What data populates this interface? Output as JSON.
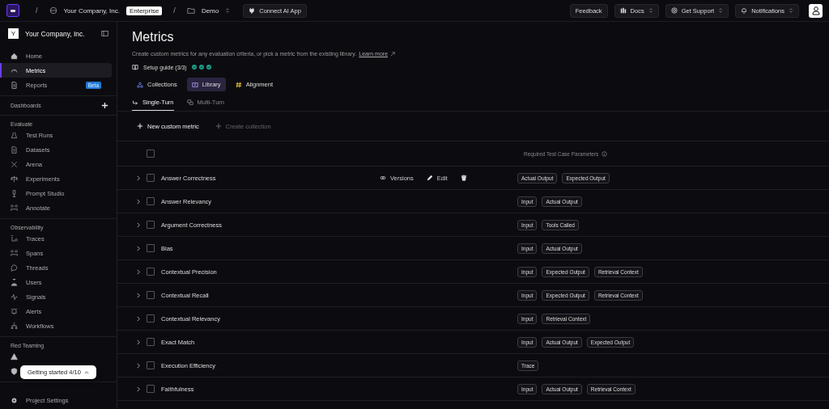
{
  "topbar": {
    "separators": [
      "/",
      "/"
    ],
    "org": "Your Company, Inc.",
    "plan": "Enterprise",
    "project": "Demo",
    "connect": "Connect AI App",
    "buttons": [
      {
        "label": "Feedback",
        "kind": "plain"
      },
      {
        "label": "Docs",
        "kind": "docs"
      },
      {
        "label": "Get Support",
        "kind": "support"
      },
      {
        "label": "Notifications",
        "kind": "bell"
      }
    ]
  },
  "sidebar": {
    "company": "Your Company, Inc.",
    "logo_letter": "Y",
    "top_items": [
      {
        "label": "Home",
        "selected": false
      },
      {
        "label": "Metrics",
        "selected": true
      },
      {
        "label": "Reports",
        "selected": false,
        "badge": "Beta"
      }
    ],
    "dashboards": "Dashboards",
    "sections": [
      {
        "title": "Evaluate",
        "items": [
          {
            "label": "Test Runs"
          },
          {
            "label": "Datasets"
          },
          {
            "label": "Arena"
          },
          {
            "label": "Experiments"
          },
          {
            "label": "Prompt Studio"
          },
          {
            "label": "Annotate"
          }
        ]
      },
      {
        "title": "Observability",
        "items": [
          {
            "label": "Traces"
          },
          {
            "label": "Spans"
          },
          {
            "label": "Threads"
          },
          {
            "label": "Users"
          },
          {
            "label": "Signals"
          },
          {
            "label": "Alerts"
          },
          {
            "label": "Workflows"
          }
        ]
      },
      {
        "title": "Red Teaming"
      }
    ],
    "settings": "Project Settings",
    "popup": "Getting started 4/10"
  },
  "page": {
    "title": "Metrics",
    "description": "Create custom metrics for any evaluation criteria, or pick a metric from the existing library.",
    "learn_more": "Learn more",
    "setup_guide": "Setup guide (3/3)",
    "setup_steps": [
      {
        "done": true
      },
      {
        "done": true
      },
      {
        "done": true
      }
    ],
    "tabs": [
      {
        "label": "Collections",
        "selected": false
      },
      {
        "label": "Library",
        "selected": true
      },
      {
        "label": "Alignment",
        "selected": false
      }
    ],
    "subtabs": [
      {
        "label": "Single-Turn",
        "selected": true
      },
      {
        "label": "Multi-Turn",
        "selected": false
      }
    ],
    "actions": [
      {
        "label": "New custom metric",
        "disabled": false
      },
      {
        "label": "Create collection",
        "disabled": true
      }
    ]
  },
  "table": {
    "header_checked": false,
    "params_header": "Required Test Case Parameters",
    "rows": [
      {
        "name": "Answer Correctness",
        "checked": false,
        "actions": [
          "Versions",
          "Edit"
        ],
        "params": [
          "Actual Output",
          "Expected Output"
        ]
      },
      {
        "name": "Answer Relevancy",
        "checked": false,
        "params": [
          "Input",
          "Actual Output"
        ]
      },
      {
        "name": "Argument Correctness",
        "checked": false,
        "params": [
          "Input",
          "Tools Called"
        ]
      },
      {
        "name": "Bias",
        "checked": false,
        "params": [
          "Input",
          "Actual Output"
        ]
      },
      {
        "name": "Contextual Precision",
        "checked": false,
        "params": [
          "Input",
          "Expected Output",
          "Retrieval Context"
        ]
      },
      {
        "name": "Contextual Recall",
        "checked": false,
        "params": [
          "Input",
          "Expected Output",
          "Retrieval Context"
        ]
      },
      {
        "name": "Contextual Relevancy",
        "checked": false,
        "params": [
          "Input",
          "Retrieval Context"
        ]
      },
      {
        "name": "Exact Match",
        "checked": false,
        "params": [
          "Input",
          "Actual Output",
          "Expected Output"
        ]
      },
      {
        "name": "Execution Efficiency",
        "checked": false,
        "params": [
          "Trace"
        ]
      },
      {
        "name": "Faithfulness",
        "checked": false,
        "params": [
          "Input",
          "Actual Output",
          "Retrieval Context"
        ]
      }
    ]
  }
}
